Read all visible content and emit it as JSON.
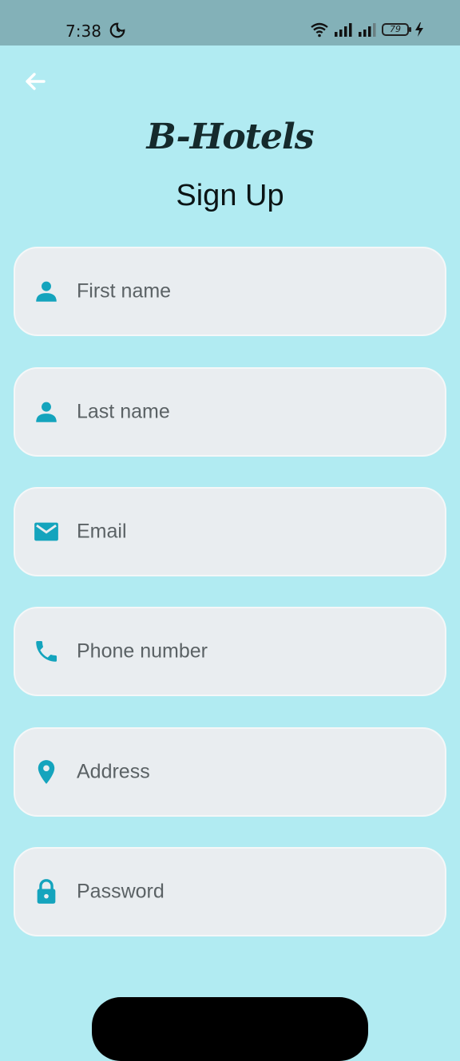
{
  "status_bar": {
    "time": "7:38",
    "battery": "79"
  },
  "header": {
    "brand": "B-Hotels",
    "title": "Sign Up"
  },
  "form": {
    "fields": [
      {
        "name": "first-name-field",
        "placeholder": "First name",
        "icon": "person-icon"
      },
      {
        "name": "last-name-field",
        "placeholder": "Last name",
        "icon": "person-icon"
      },
      {
        "name": "email-field",
        "placeholder": "Email",
        "icon": "mail-icon"
      },
      {
        "name": "phone-field",
        "placeholder": "Phone number",
        "icon": "phone-icon"
      },
      {
        "name": "address-field",
        "placeholder": "Address",
        "icon": "location-pin-icon"
      },
      {
        "name": "password-field",
        "placeholder": "Password",
        "icon": "lock-icon"
      }
    ]
  },
  "colors": {
    "background": "#b1ebf2",
    "status_bar": "#83b1b8",
    "accent": "#14a4bd",
    "field_bg": "#e9edf0"
  }
}
